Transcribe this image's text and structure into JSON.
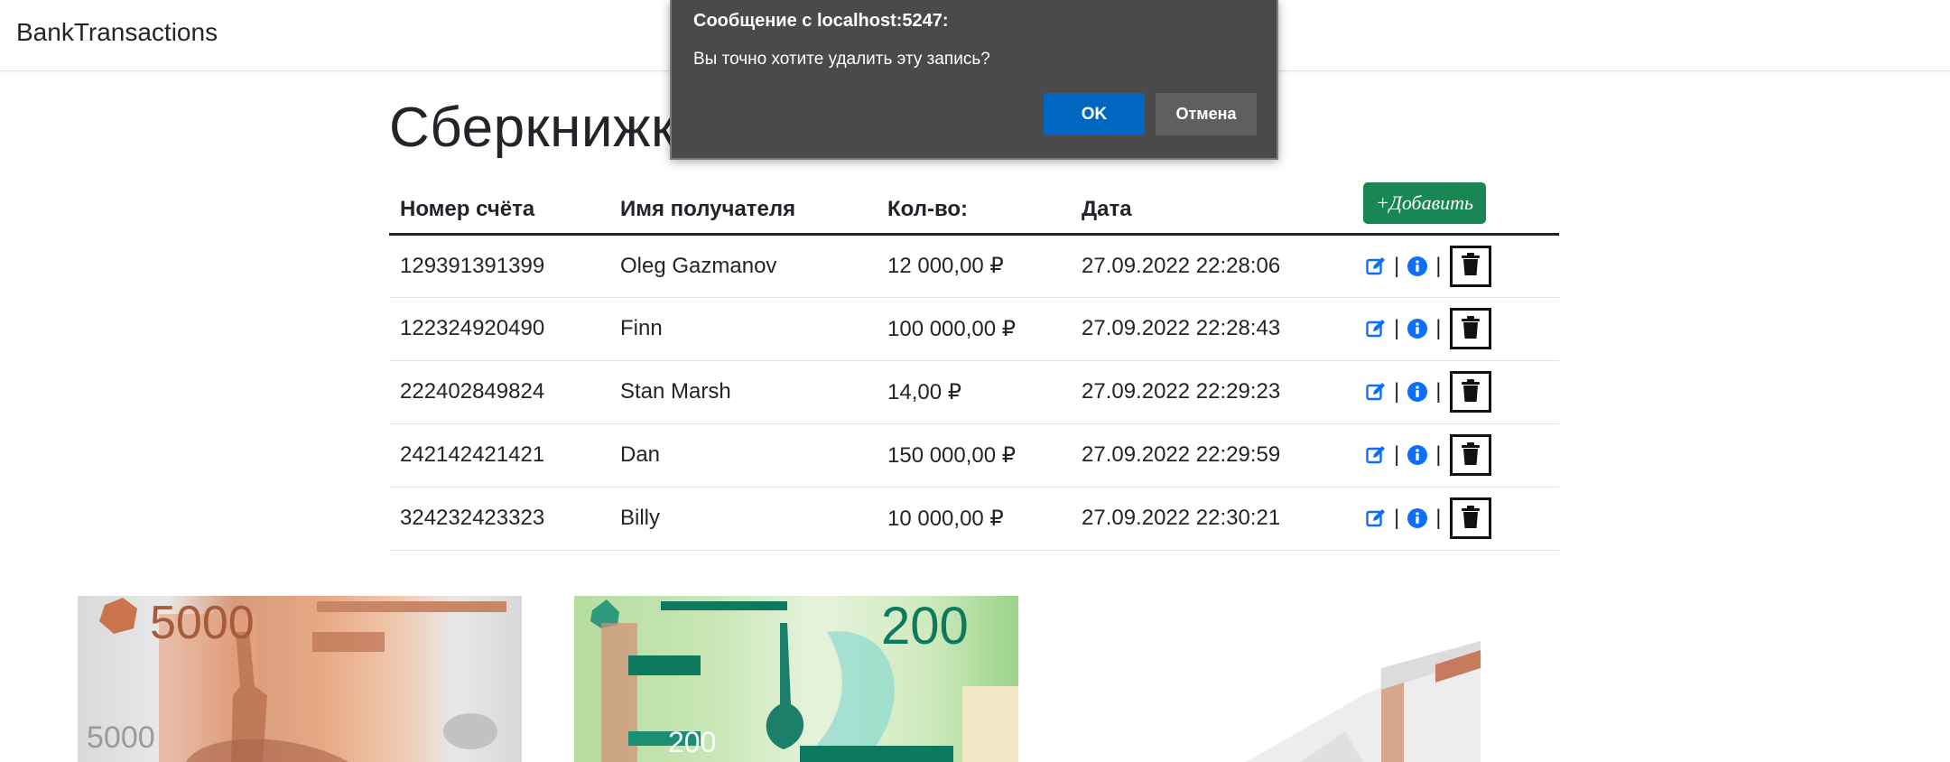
{
  "navbar": {
    "brand": "BankTransactions"
  },
  "page": {
    "title": "Сберкнижка"
  },
  "table": {
    "headers": [
      "Номер счёта",
      "Имя получателя",
      "Кол-во:",
      "Дата"
    ],
    "add_button_label": "+Добавить",
    "rows": [
      {
        "account": "129391391399",
        "recipient": "Oleg Gazmanov",
        "amount": "12 000,00 ₽",
        "date": "27.09.2022 22:28:06"
      },
      {
        "account": "122324920490",
        "recipient": "Finn",
        "amount": "100 000,00 ₽",
        "date": "27.09.2022 22:28:43"
      },
      {
        "account": "222402849824",
        "recipient": "Stan Marsh",
        "amount": "14,00 ₽",
        "date": "27.09.2022 22:29:23"
      },
      {
        "account": "242142421421",
        "recipient": "Dan",
        "amount": "150 000,00 ₽",
        "date": "27.09.2022 22:29:59"
      },
      {
        "account": "324232423323",
        "recipient": "Billy",
        "amount": "10 000,00 ₽",
        "date": "27.09.2022 22:30:21"
      }
    ],
    "action_separator": "|"
  },
  "images": {
    "bill_5000": {
      "big": "5000",
      "small": "5000"
    },
    "bill_200": {
      "big": "200",
      "small": "200"
    }
  },
  "dialog": {
    "title": "Сообщение с localhost:5247:",
    "message": "Вы точно хотите удалить эту запись?",
    "ok_label": "OK",
    "cancel_label": "Отмена"
  },
  "colors": {
    "primary": "#0d6efd",
    "success": "#198754",
    "dialog_bg": "#4a4a4a",
    "ok": "#0067c0"
  },
  "icons": {
    "edit": "edit-icon",
    "info": "info-icon",
    "delete": "trash-icon"
  }
}
